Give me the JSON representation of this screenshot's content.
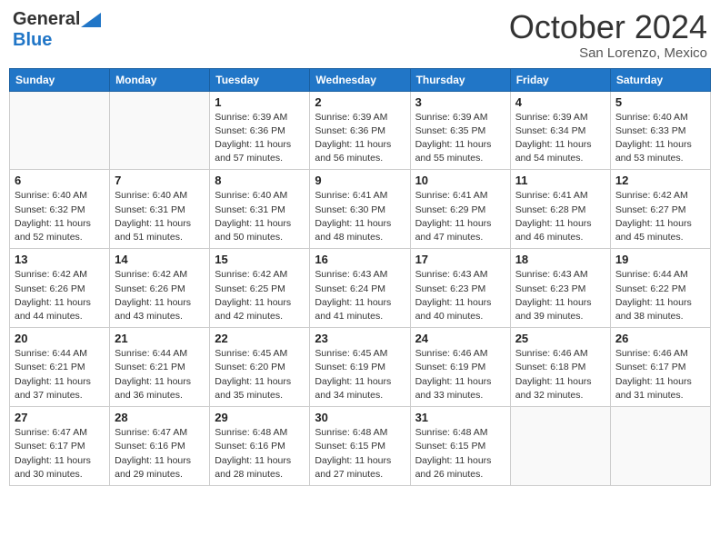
{
  "header": {
    "logo_general": "General",
    "logo_blue": "Blue",
    "month_year": "October 2024",
    "location": "San Lorenzo, Mexico"
  },
  "days_of_week": [
    "Sunday",
    "Monday",
    "Tuesday",
    "Wednesday",
    "Thursday",
    "Friday",
    "Saturday"
  ],
  "weeks": [
    [
      {
        "day": "",
        "info": ""
      },
      {
        "day": "",
        "info": ""
      },
      {
        "day": "1",
        "info": "Sunrise: 6:39 AM\nSunset: 6:36 PM\nDaylight: 11 hours and 57 minutes."
      },
      {
        "day": "2",
        "info": "Sunrise: 6:39 AM\nSunset: 6:36 PM\nDaylight: 11 hours and 56 minutes."
      },
      {
        "day": "3",
        "info": "Sunrise: 6:39 AM\nSunset: 6:35 PM\nDaylight: 11 hours and 55 minutes."
      },
      {
        "day": "4",
        "info": "Sunrise: 6:39 AM\nSunset: 6:34 PM\nDaylight: 11 hours and 54 minutes."
      },
      {
        "day": "5",
        "info": "Sunrise: 6:40 AM\nSunset: 6:33 PM\nDaylight: 11 hours and 53 minutes."
      }
    ],
    [
      {
        "day": "6",
        "info": "Sunrise: 6:40 AM\nSunset: 6:32 PM\nDaylight: 11 hours and 52 minutes."
      },
      {
        "day": "7",
        "info": "Sunrise: 6:40 AM\nSunset: 6:31 PM\nDaylight: 11 hours and 51 minutes."
      },
      {
        "day": "8",
        "info": "Sunrise: 6:40 AM\nSunset: 6:31 PM\nDaylight: 11 hours and 50 minutes."
      },
      {
        "day": "9",
        "info": "Sunrise: 6:41 AM\nSunset: 6:30 PM\nDaylight: 11 hours and 48 minutes."
      },
      {
        "day": "10",
        "info": "Sunrise: 6:41 AM\nSunset: 6:29 PM\nDaylight: 11 hours and 47 minutes."
      },
      {
        "day": "11",
        "info": "Sunrise: 6:41 AM\nSunset: 6:28 PM\nDaylight: 11 hours and 46 minutes."
      },
      {
        "day": "12",
        "info": "Sunrise: 6:42 AM\nSunset: 6:27 PM\nDaylight: 11 hours and 45 minutes."
      }
    ],
    [
      {
        "day": "13",
        "info": "Sunrise: 6:42 AM\nSunset: 6:26 PM\nDaylight: 11 hours and 44 minutes."
      },
      {
        "day": "14",
        "info": "Sunrise: 6:42 AM\nSunset: 6:26 PM\nDaylight: 11 hours and 43 minutes."
      },
      {
        "day": "15",
        "info": "Sunrise: 6:42 AM\nSunset: 6:25 PM\nDaylight: 11 hours and 42 minutes."
      },
      {
        "day": "16",
        "info": "Sunrise: 6:43 AM\nSunset: 6:24 PM\nDaylight: 11 hours and 41 minutes."
      },
      {
        "day": "17",
        "info": "Sunrise: 6:43 AM\nSunset: 6:23 PM\nDaylight: 11 hours and 40 minutes."
      },
      {
        "day": "18",
        "info": "Sunrise: 6:43 AM\nSunset: 6:23 PM\nDaylight: 11 hours and 39 minutes."
      },
      {
        "day": "19",
        "info": "Sunrise: 6:44 AM\nSunset: 6:22 PM\nDaylight: 11 hours and 38 minutes."
      }
    ],
    [
      {
        "day": "20",
        "info": "Sunrise: 6:44 AM\nSunset: 6:21 PM\nDaylight: 11 hours and 37 minutes."
      },
      {
        "day": "21",
        "info": "Sunrise: 6:44 AM\nSunset: 6:21 PM\nDaylight: 11 hours and 36 minutes."
      },
      {
        "day": "22",
        "info": "Sunrise: 6:45 AM\nSunset: 6:20 PM\nDaylight: 11 hours and 35 minutes."
      },
      {
        "day": "23",
        "info": "Sunrise: 6:45 AM\nSunset: 6:19 PM\nDaylight: 11 hours and 34 minutes."
      },
      {
        "day": "24",
        "info": "Sunrise: 6:46 AM\nSunset: 6:19 PM\nDaylight: 11 hours and 33 minutes."
      },
      {
        "day": "25",
        "info": "Sunrise: 6:46 AM\nSunset: 6:18 PM\nDaylight: 11 hours and 32 minutes."
      },
      {
        "day": "26",
        "info": "Sunrise: 6:46 AM\nSunset: 6:17 PM\nDaylight: 11 hours and 31 minutes."
      }
    ],
    [
      {
        "day": "27",
        "info": "Sunrise: 6:47 AM\nSunset: 6:17 PM\nDaylight: 11 hours and 30 minutes."
      },
      {
        "day": "28",
        "info": "Sunrise: 6:47 AM\nSunset: 6:16 PM\nDaylight: 11 hours and 29 minutes."
      },
      {
        "day": "29",
        "info": "Sunrise: 6:48 AM\nSunset: 6:16 PM\nDaylight: 11 hours and 28 minutes."
      },
      {
        "day": "30",
        "info": "Sunrise: 6:48 AM\nSunset: 6:15 PM\nDaylight: 11 hours and 27 minutes."
      },
      {
        "day": "31",
        "info": "Sunrise: 6:48 AM\nSunset: 6:15 PM\nDaylight: 11 hours and 26 minutes."
      },
      {
        "day": "",
        "info": ""
      },
      {
        "day": "",
        "info": ""
      }
    ]
  ]
}
